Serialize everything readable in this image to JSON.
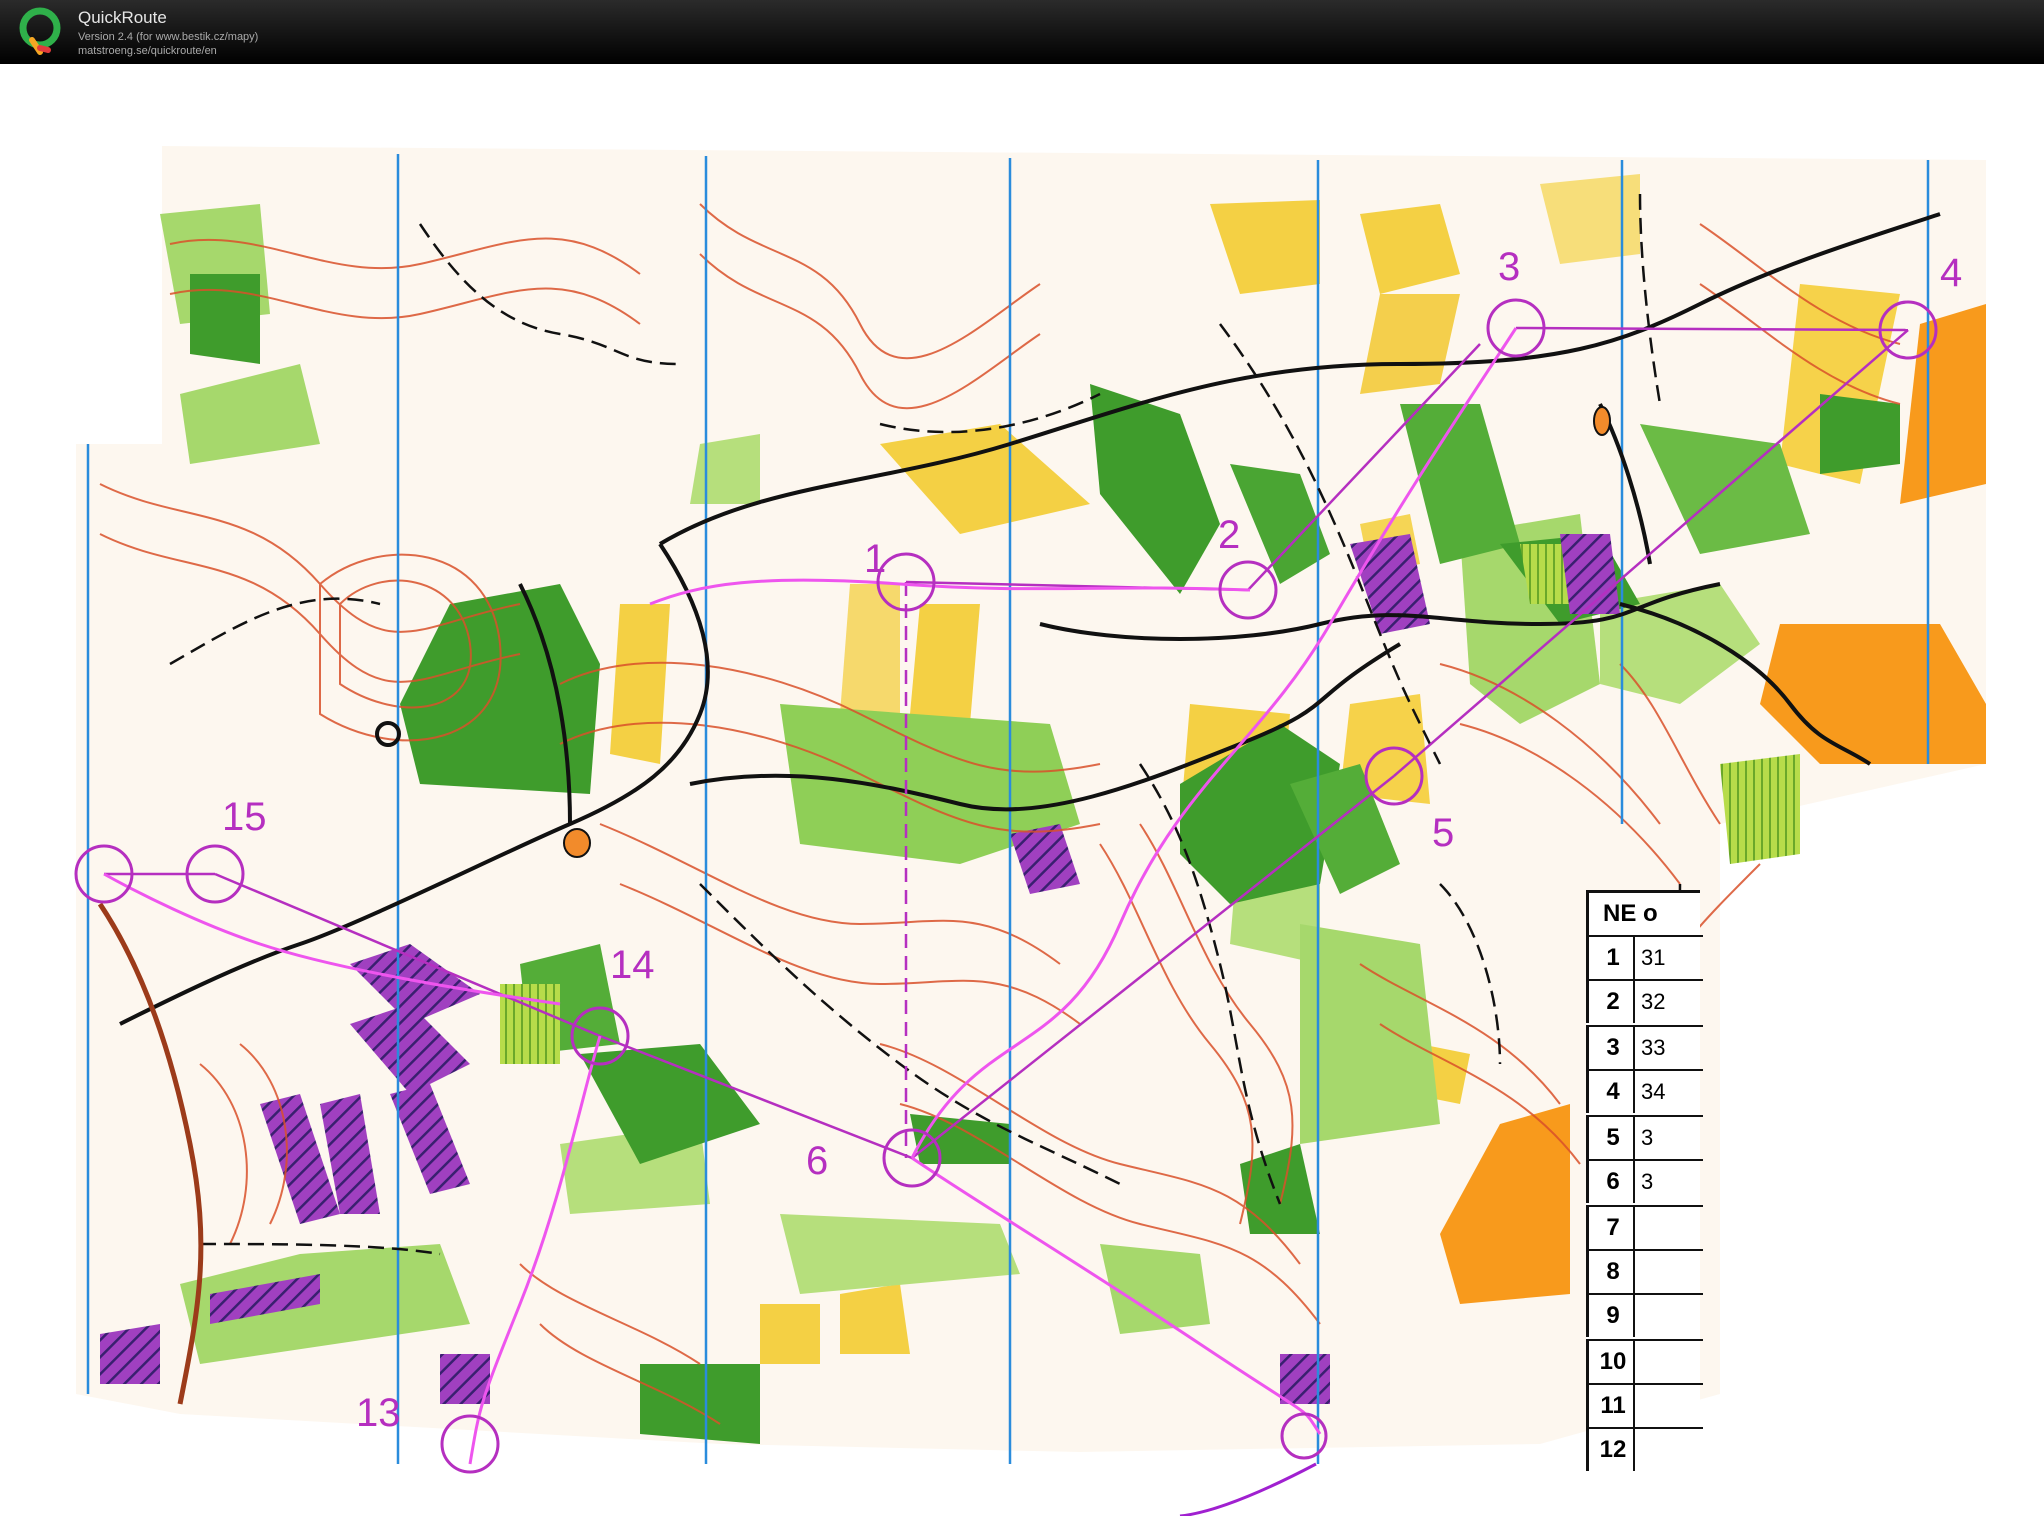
{
  "app": {
    "name": "QuickRoute",
    "version": "Version 2.4  (for www.bestik.cz/mapy)",
    "url": "matstroeng.se/quickroute/en"
  },
  "map": {
    "control_labels": [
      "3",
      "4",
      "2",
      "1",
      "5",
      "15",
      "14",
      "6",
      "13"
    ],
    "legend": {
      "header": "NE o",
      "rows": [
        {
          "num": "1",
          "code": "31"
        },
        {
          "num": "2",
          "code": "32"
        },
        {
          "num": "3",
          "code": "33"
        },
        {
          "num": "4",
          "code": "34"
        },
        {
          "num": "5",
          "code": "3"
        },
        {
          "num": "6",
          "code": "3"
        },
        {
          "num": "7",
          "code": ""
        },
        {
          "num": "8",
          "code": ""
        },
        {
          "num": "9",
          "code": ""
        },
        {
          "num": "10",
          "code": ""
        },
        {
          "num": "11",
          "code": ""
        },
        {
          "num": "12",
          "code": ""
        }
      ]
    },
    "colors": {
      "course": "#b52fc0",
      "route": "#ee55ee",
      "contour": "#d9512a",
      "forest": "#3f9c2c",
      "light_forest": "#9cd46a",
      "open": "#f4d044",
      "rough_open": "#f89a1c",
      "north_line": "#2a8cdc"
    }
  }
}
